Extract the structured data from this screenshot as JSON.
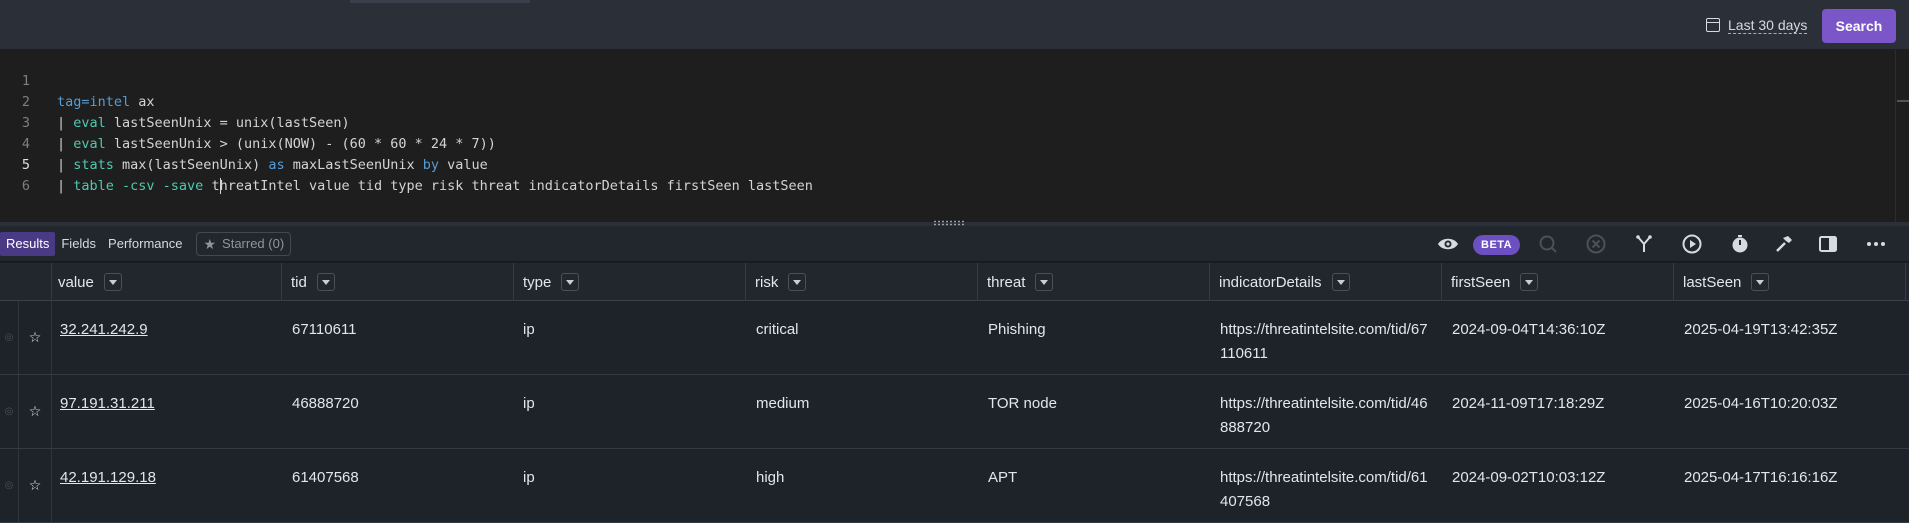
{
  "header": {
    "date_range_label": "Last 30 days",
    "search_label": "Search"
  },
  "editor": {
    "lines": [
      {
        "n": "1"
      },
      {
        "n": "2"
      },
      {
        "n": "3"
      },
      {
        "n": "4"
      },
      {
        "n": "5"
      },
      {
        "n": "6"
      }
    ],
    "line1": {
      "kw": "tag=intel",
      "rest": " ax"
    },
    "line2": {
      "pipe": "| ",
      "cmd": "eval",
      "rest": " lastSeenUnix = unix(lastSeen)"
    },
    "line3": {
      "pipe": "| ",
      "cmd": "eval",
      "rest": " lastSeenUnix > (unix(NOW) - (60 * 60 * 24 * 7))"
    },
    "line4": {
      "pipe": "| ",
      "cmd": "stats",
      "mid": " max(lastSeenUnix) ",
      "as": "as",
      "mid2": " maxLastSeenUnix ",
      "by": "by",
      "rest": " value"
    },
    "line5": {
      "pipe": "| ",
      "cmd": "table",
      "opts": " -csv -save ",
      "pre_caret": "t",
      "rest": "hreatIntel value tid type risk threat indicatorDetails firstSeen lastSeen"
    }
  },
  "results": {
    "tabs": [
      {
        "label": "Results"
      },
      {
        "label": "Fields"
      },
      {
        "label": "Performance"
      },
      {
        "label": "Starred (0)"
      }
    ],
    "beta_label": "BETA",
    "toolbar_icons": [
      "eye-icon",
      "disabled-scan-icon",
      "close-circle-icon",
      "fork-icon",
      "play-icon",
      "timer-icon",
      "hammer-icon",
      "panel-toggle-icon",
      "more-icon"
    ]
  },
  "table": {
    "columns": [
      "value",
      "tid",
      "type",
      "risk",
      "threat",
      "indicatorDetails",
      "firstSeen",
      "lastSeen"
    ],
    "rows": [
      {
        "value": "32.241.242.9",
        "tid": "67110611",
        "type": "ip",
        "risk": "critical",
        "threat": "Phishing",
        "indicatorDetails": "https://threatintelsite.com/tid/67110611",
        "firstSeen": "2024-09-04T14:36:10Z",
        "lastSeen": "2025-04-19T13:42:35Z"
      },
      {
        "value": "97.191.31.211",
        "tid": "46888720",
        "type": "ip",
        "risk": "medium",
        "threat": "TOR node",
        "indicatorDetails": "https://threatintelsite.com/tid/46888720",
        "firstSeen": "2024-11-09T17:18:29Z",
        "lastSeen": "2025-04-16T10:20:03Z"
      },
      {
        "value": "42.191.129.18",
        "tid": "61407568",
        "type": "ip",
        "risk": "high",
        "threat": "APT",
        "indicatorDetails": "https://threatintelsite.com/tid/61407568",
        "firstSeen": "2024-09-02T10:03:12Z",
        "lastSeen": "2025-04-17T16:16:16Z"
      }
    ]
  },
  "colors": {
    "accent": "#7b56c9",
    "keyword": "#569cd6",
    "command": "#4ec9b0"
  }
}
